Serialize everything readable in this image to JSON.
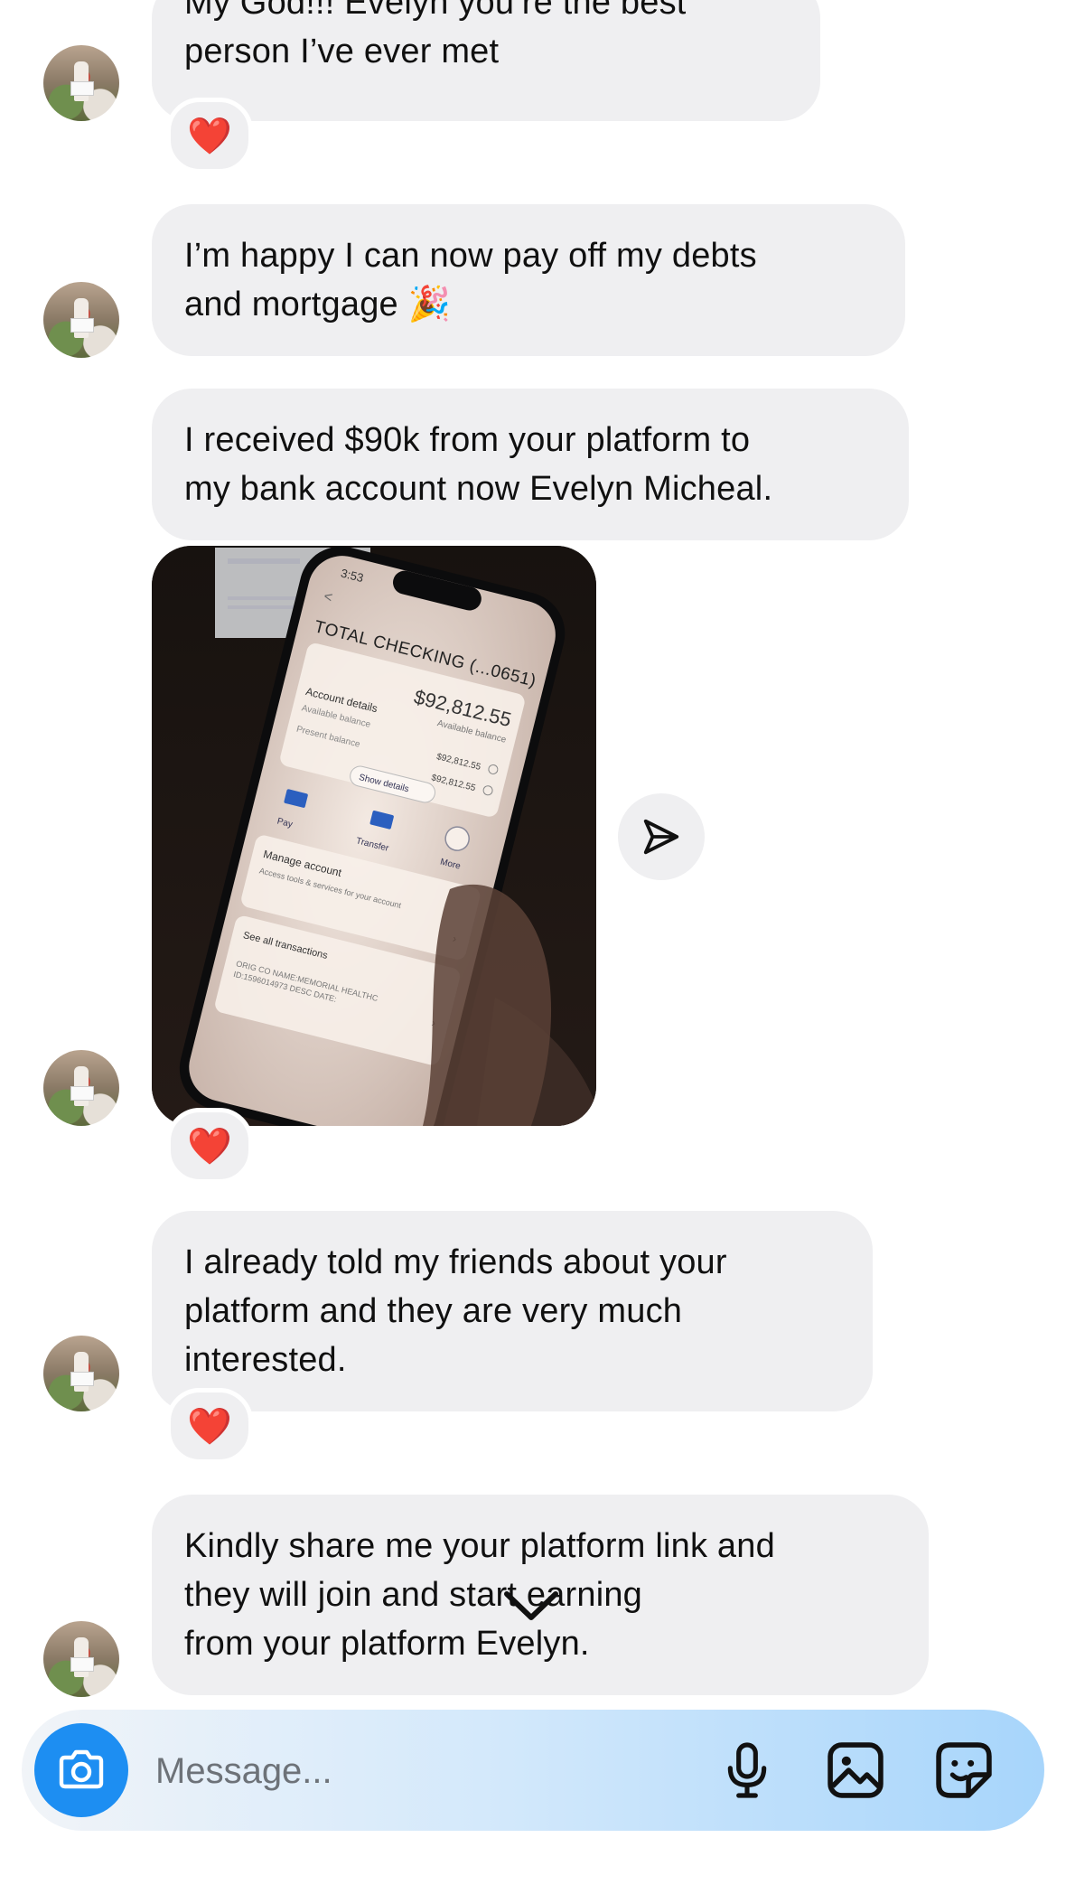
{
  "messages": [
    {
      "lines": [
        "My God!!! Evelyn you’re the best",
        "person I’ve ever met"
      ],
      "reaction": "❤️"
    },
    {
      "lines": [
        "I’m happy I can now pay off my debts",
        "and mortgage 🎉"
      ]
    },
    {
      "lines": [
        "I received $90k from your platform to",
        "my bank account now Evelyn Micheal."
      ]
    },
    {
      "photo": {
        "time": "3:53",
        "account": "TOTAL CHECKING (...0651)",
        "balance": "$92,812.55",
        "balance_label": "Available balance",
        "details_title": "Account details",
        "rows": [
          {
            "label": "Available balance",
            "value": "$92,812.55"
          },
          {
            "label": "Present balance",
            "value": "$92,812.55"
          }
        ],
        "show_details": "Show details",
        "actions": [
          "Pay",
          "Transfer",
          "More"
        ],
        "manage_title": "Manage account",
        "manage_sub": "Access tools & services for your account",
        "see_all": "See all transactions",
        "txn_line1": "ORIG CO NAME:MEMORIAL HEALTHC",
        "txn_line2": "ID:1596014973 DESC DATE:"
      },
      "reaction": "❤️"
    },
    {
      "lines": [
        "I already told my friends about your",
        "platform and they are very much",
        "interested."
      ],
      "reaction": "❤️"
    },
    {
      "lines": [
        "Kindly share me your platform link and",
        "they will join and start earning",
        "from your platform Evelyn."
      ]
    }
  ],
  "composer": {
    "placeholder": "Message..."
  },
  "icons": {
    "reaction": "heart-icon",
    "share": "paper-plane-icon",
    "scroll": "chevron-down-icon",
    "camera": "camera-icon",
    "mic": "microphone-icon",
    "gallery": "image-icon",
    "sticker": "sticker-icon"
  },
  "colors": {
    "bubble": "#efeff1",
    "camera": "#1d8ef2",
    "heart": "#e2233f"
  }
}
